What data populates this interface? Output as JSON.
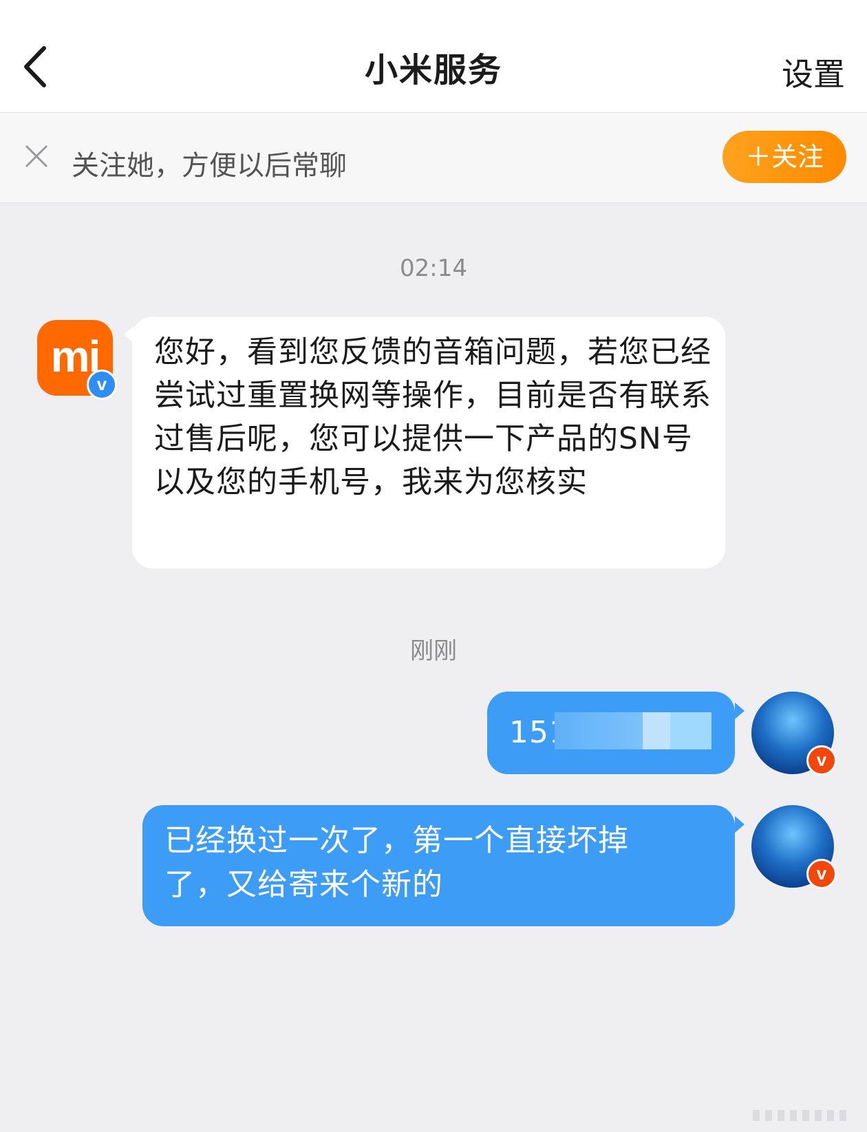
{
  "header": {
    "title": "小米服务",
    "settings_label": "设置"
  },
  "follow_bar": {
    "prompt": "关注她，方便以后常聊",
    "follow_button": "＋关注"
  },
  "messages": [
    {
      "timestamp": "02:14",
      "sender": "小米服务",
      "direction": "incoming",
      "avatar_text": "mi",
      "text": "您好，看到您反馈的音箱问题，若您已经尝试过重置换网等操作，目前是否有联系过售后呢，您可以提供一下产品的SN号以及您的手机号，我来为您核实"
    },
    {
      "timestamp": "刚刚",
      "direction": "outgoing",
      "text": "151"
    },
    {
      "direction": "outgoing",
      "text": "已经换过一次了，第一个直接坏掉了，又给寄来个新的"
    }
  ],
  "badges": {
    "official": "v",
    "verified_user": "v"
  },
  "colors": {
    "accent_orange": "#ff8a00",
    "bubble_blue": "#3d9cf6",
    "mi_orange": "#ff6900"
  }
}
